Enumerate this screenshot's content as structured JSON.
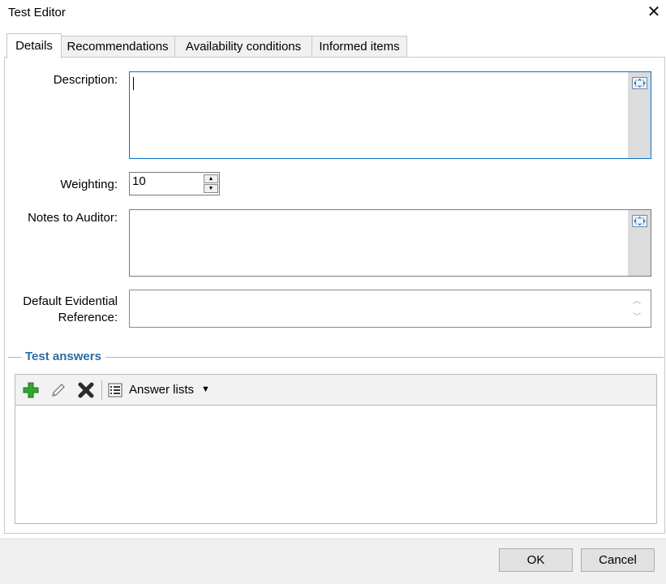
{
  "window": {
    "title": "Test Editor",
    "close_glyph": "✕"
  },
  "tabs": [
    {
      "label": "Details",
      "active": true
    },
    {
      "label": "Recommendations",
      "active": false
    },
    {
      "label": "Availability conditions",
      "active": false
    },
    {
      "label": "Informed items",
      "active": false
    }
  ],
  "form": {
    "description_label": "Description:",
    "description_value": "",
    "weighting_label": "Weighting:",
    "weighting_value": "10",
    "notes_label": "Notes to Auditor:",
    "notes_value": "",
    "evidential_label_line1": "Default Evidential",
    "evidential_label_line2": "Reference:",
    "evidential_value": ""
  },
  "answers": {
    "group_title": "Test answers",
    "toolbar": {
      "add_icon": "plus-icon",
      "edit_icon": "pencil-icon",
      "delete_icon": "delete-x-icon",
      "answer_lists_label": "Answer lists"
    },
    "rows": []
  },
  "footer": {
    "ok_label": "OK",
    "cancel_label": "Cancel"
  },
  "colors": {
    "accent": "#0a73c9",
    "group_title": "#2d6ca2",
    "add_green": "#2fa82f"
  }
}
